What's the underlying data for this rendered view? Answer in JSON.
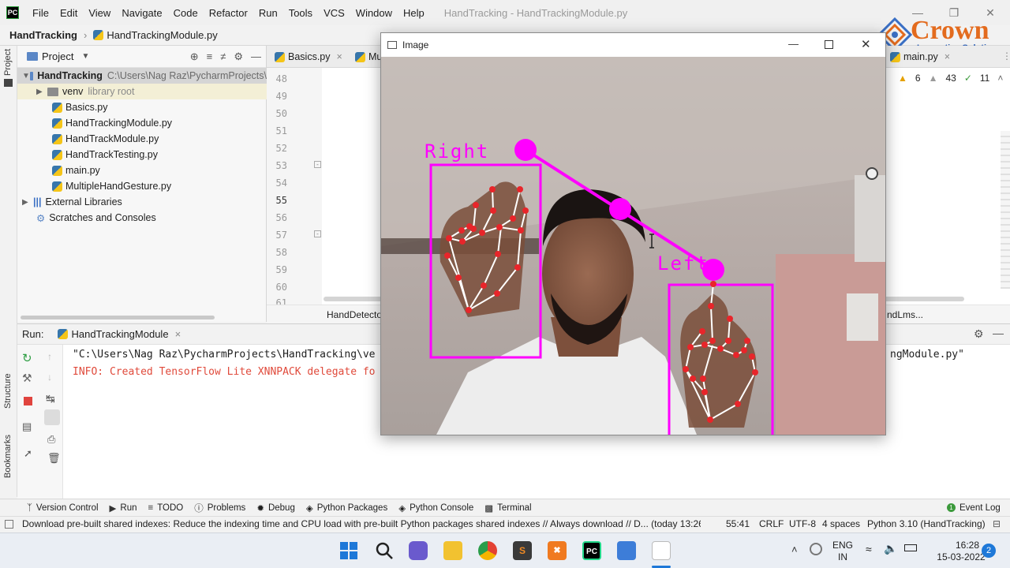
{
  "menubar": {
    "items": [
      "File",
      "Edit",
      "View",
      "Navigate",
      "Code",
      "Refactor",
      "Run",
      "Tools",
      "VCS",
      "Window",
      "Help"
    ],
    "window_title": "HandTracking - HandTrackingModule.py"
  },
  "breadcrumb": {
    "project": "HandTracking",
    "file": "HandTrackingModule.py"
  },
  "project_panel": {
    "title": "Project",
    "root_name": "HandTracking",
    "root_path": "C:\\Users\\Nag Raz\\PycharmProjects\\",
    "venv": "venv",
    "venv_note": "library root",
    "files": [
      "Basics.py",
      "HandTrackingModule.py",
      "HandTrackModule.py",
      "HandTrackTesting.py",
      "main.py",
      "MultipleHandGesture.py"
    ],
    "external_libraries": "External Libraries",
    "scratches": "Scratches and Consoles"
  },
  "editor": {
    "tabs": [
      "Basics.py",
      "Mu",
      "main.py"
    ],
    "line_numbers": [
      "48",
      "49",
      "50",
      "51",
      "52",
      "53",
      "54",
      "55",
      "56",
      "57",
      "58",
      "59",
      "60",
      "61"
    ],
    "warnings": "6",
    "weak_warnings": "43",
    "checks": "11",
    "breadcrumb_left": "HandDetecto",
    "breadcrumb_right": "ndLms..."
  },
  "run_panel": {
    "label": "Run:",
    "config": "HandTrackingModule",
    "line1_left": "\"C:\\Users\\Nag Raz\\PycharmProjects\\HandTracking\\ve",
    "line1_right": "ngModule.py\"",
    "line2": "INFO: Created TensorFlow Lite XNNPACK delegate fo"
  },
  "left_strip": {
    "project": "Project",
    "structure": "Structure",
    "bookmarks": "Bookmarks"
  },
  "bottom_tools": [
    "Version Control",
    "Run",
    "TODO",
    "Problems",
    "Debug",
    "Python Packages",
    "Python Console",
    "Terminal"
  ],
  "event_log": "Event Log",
  "status_bar": {
    "message": "Download pre-built shared indexes: Reduce the indexing time and CPU load with pre-built Python packages shared indexes // Always download // D... (today 13:26",
    "position": "55:41",
    "line_ending": "CRLF",
    "encoding": "UTF-8",
    "indent": "4 spaces",
    "interpreter": "Python 3.10 (HandTracking)"
  },
  "image_window": {
    "title": "Image",
    "label_right": "Right",
    "label_left": "Left"
  },
  "taskbar": {
    "lang_line1": "ENG",
    "lang_line2": "IN",
    "time": "16:28",
    "date": "15-03-2022",
    "notifications": "2"
  },
  "watermark": {
    "brand": "Crown",
    "tagline": "Innovative Solutions"
  },
  "colors": {
    "magenta": "#ff00ff",
    "keypoint_red": "#e8252a",
    "run_error": "#e04a3b"
  }
}
